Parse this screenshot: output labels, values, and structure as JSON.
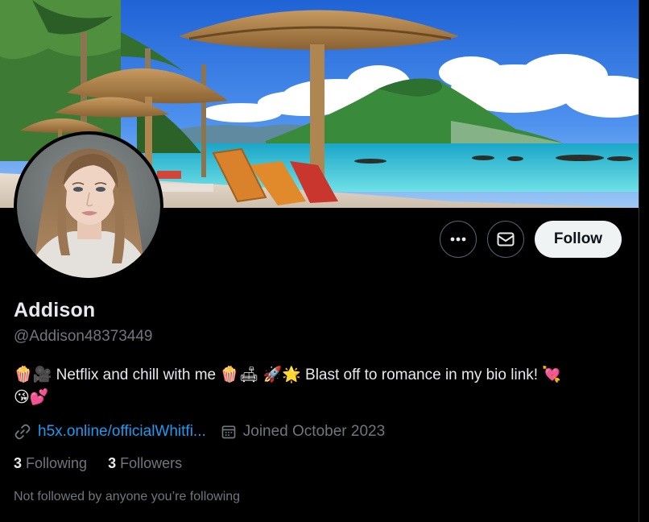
{
  "profile": {
    "name": "Addison",
    "handle": "@Addison48373449",
    "bio_line1": "🍿🎥 Netflix and chill with me 🍿🛋 🚀🌟 Blast off to romance in my bio link! 💘",
    "bio_line2": "😘💕",
    "link": "h5x.online/officialWhitfi...",
    "joined": "Joined October 2023",
    "following_count": "3",
    "following_label": "Following",
    "followers_count": "3",
    "followers_label": "Followers",
    "not_followed_note": "Not followed by anyone you’re following"
  },
  "actions": {
    "follow_label": "Follow",
    "more_icon": "more-icon",
    "message_icon": "mail-icon"
  },
  "colors": {
    "background": "#000000",
    "primary_text": "#e7e9ea",
    "secondary_text": "#71767b",
    "link": "#1d9bf0",
    "follow_button_bg": "#eff3f4"
  }
}
